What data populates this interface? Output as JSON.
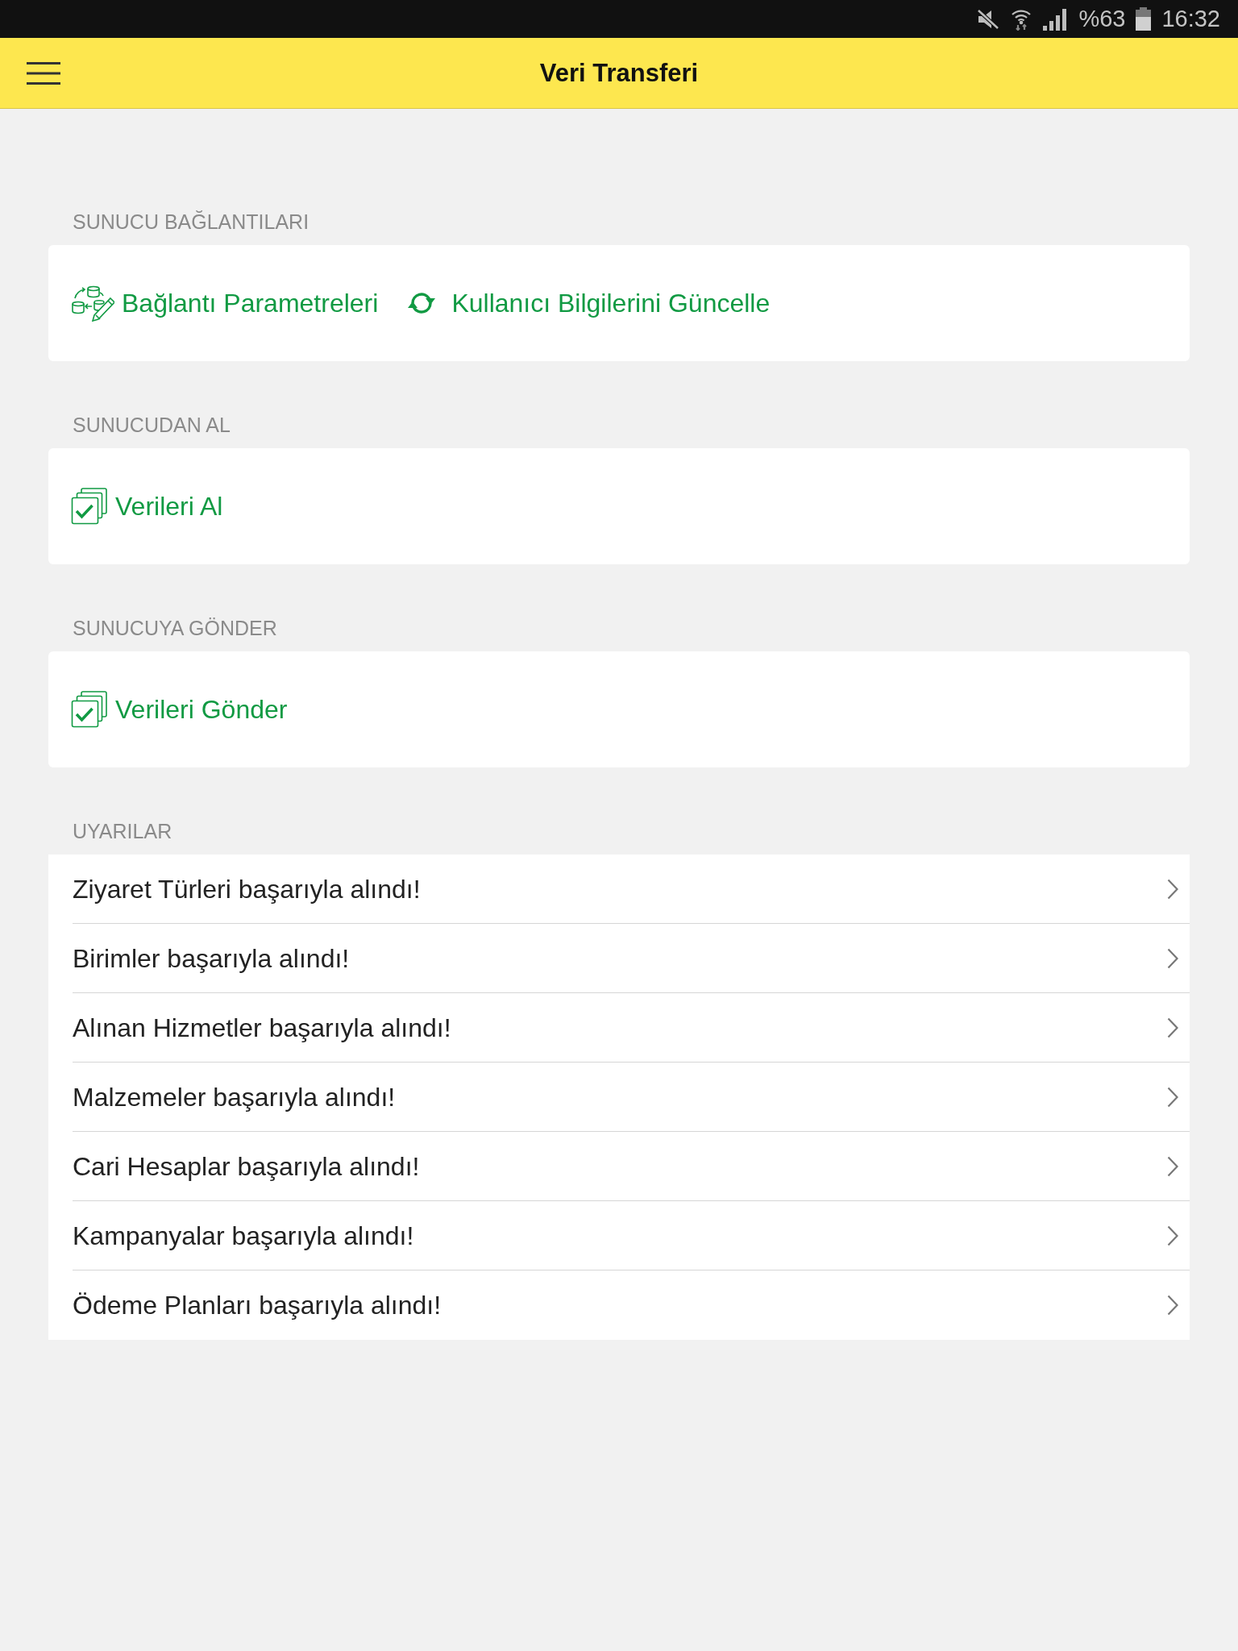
{
  "status_bar": {
    "battery": "%63",
    "time": "16:32"
  },
  "header": {
    "title": "Veri Transferi"
  },
  "sections": [
    {
      "title": "SUNUCU BAĞLANTILARI",
      "kind": "actions",
      "items": [
        {
          "label": "Bağlantı Parametreleri",
          "kind": "connection"
        },
        {
          "label": "Kullanıcı Bilgilerini Güncelle",
          "kind": "refresh"
        }
      ]
    },
    {
      "title": "SUNUCUDAN AL",
      "kind": "actions",
      "items": [
        {
          "label": "Verileri Al",
          "kind": "checklist"
        }
      ]
    },
    {
      "title": "SUNUCUYA GÖNDER",
      "kind": "actions",
      "items": [
        {
          "label": "Verileri Gönder",
          "kind": "checklist"
        }
      ]
    },
    {
      "title": "UYARILAR",
      "kind": "list",
      "items": [
        {
          "label": "Ziyaret Türleri başarıyla alındı!"
        },
        {
          "label": "Birimler başarıyla alındı!"
        },
        {
          "label": "Alınan Hizmetler başarıyla alındı!"
        },
        {
          "label": "Malzemeler başarıyla alındı!"
        },
        {
          "label": "Cari Hesaplar başarıyla alındı!"
        },
        {
          "label": "Kampanyalar başarıyla alındı!"
        },
        {
          "label": "Ödeme Planları başarıyla alındı!"
        }
      ]
    }
  ]
}
